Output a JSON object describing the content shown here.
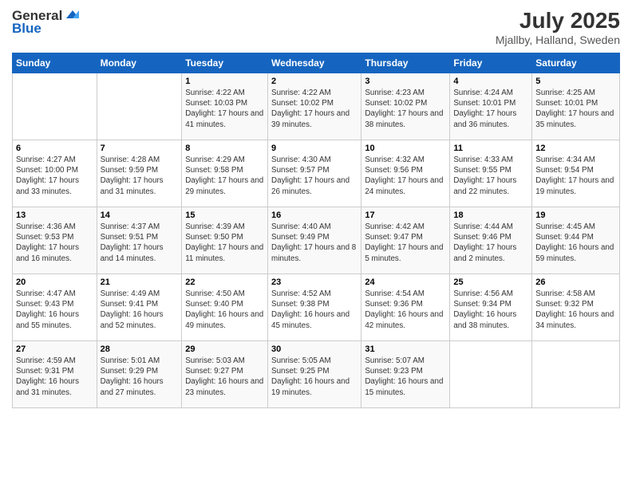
{
  "header": {
    "logo_line1": "General",
    "logo_line2": "Blue",
    "title": "July 2025",
    "subtitle": "Mjallby, Halland, Sweden"
  },
  "calendar": {
    "days_of_week": [
      "Sunday",
      "Monday",
      "Tuesday",
      "Wednesday",
      "Thursday",
      "Friday",
      "Saturday"
    ],
    "weeks": [
      [
        {
          "day": "",
          "sunrise": "",
          "sunset": "",
          "daylight": ""
        },
        {
          "day": "",
          "sunrise": "",
          "sunset": "",
          "daylight": ""
        },
        {
          "day": "1",
          "sunrise": "Sunrise: 4:22 AM",
          "sunset": "Sunset: 10:03 PM",
          "daylight": "Daylight: 17 hours and 41 minutes."
        },
        {
          "day": "2",
          "sunrise": "Sunrise: 4:22 AM",
          "sunset": "Sunset: 10:02 PM",
          "daylight": "Daylight: 17 hours and 39 minutes."
        },
        {
          "day": "3",
          "sunrise": "Sunrise: 4:23 AM",
          "sunset": "Sunset: 10:02 PM",
          "daylight": "Daylight: 17 hours and 38 minutes."
        },
        {
          "day": "4",
          "sunrise": "Sunrise: 4:24 AM",
          "sunset": "Sunset: 10:01 PM",
          "daylight": "Daylight: 17 hours and 36 minutes."
        },
        {
          "day": "5",
          "sunrise": "Sunrise: 4:25 AM",
          "sunset": "Sunset: 10:01 PM",
          "daylight": "Daylight: 17 hours and 35 minutes."
        }
      ],
      [
        {
          "day": "6",
          "sunrise": "Sunrise: 4:27 AM",
          "sunset": "Sunset: 10:00 PM",
          "daylight": "Daylight: 17 hours and 33 minutes."
        },
        {
          "day": "7",
          "sunrise": "Sunrise: 4:28 AM",
          "sunset": "Sunset: 9:59 PM",
          "daylight": "Daylight: 17 hours and 31 minutes."
        },
        {
          "day": "8",
          "sunrise": "Sunrise: 4:29 AM",
          "sunset": "Sunset: 9:58 PM",
          "daylight": "Daylight: 17 hours and 29 minutes."
        },
        {
          "day": "9",
          "sunrise": "Sunrise: 4:30 AM",
          "sunset": "Sunset: 9:57 PM",
          "daylight": "Daylight: 17 hours and 26 minutes."
        },
        {
          "day": "10",
          "sunrise": "Sunrise: 4:32 AM",
          "sunset": "Sunset: 9:56 PM",
          "daylight": "Daylight: 17 hours and 24 minutes."
        },
        {
          "day": "11",
          "sunrise": "Sunrise: 4:33 AM",
          "sunset": "Sunset: 9:55 PM",
          "daylight": "Daylight: 17 hours and 22 minutes."
        },
        {
          "day": "12",
          "sunrise": "Sunrise: 4:34 AM",
          "sunset": "Sunset: 9:54 PM",
          "daylight": "Daylight: 17 hours and 19 minutes."
        }
      ],
      [
        {
          "day": "13",
          "sunrise": "Sunrise: 4:36 AM",
          "sunset": "Sunset: 9:53 PM",
          "daylight": "Daylight: 17 hours and 16 minutes."
        },
        {
          "day": "14",
          "sunrise": "Sunrise: 4:37 AM",
          "sunset": "Sunset: 9:51 PM",
          "daylight": "Daylight: 17 hours and 14 minutes."
        },
        {
          "day": "15",
          "sunrise": "Sunrise: 4:39 AM",
          "sunset": "Sunset: 9:50 PM",
          "daylight": "Daylight: 17 hours and 11 minutes."
        },
        {
          "day": "16",
          "sunrise": "Sunrise: 4:40 AM",
          "sunset": "Sunset: 9:49 PM",
          "daylight": "Daylight: 17 hours and 8 minutes."
        },
        {
          "day": "17",
          "sunrise": "Sunrise: 4:42 AM",
          "sunset": "Sunset: 9:47 PM",
          "daylight": "Daylight: 17 hours and 5 minutes."
        },
        {
          "day": "18",
          "sunrise": "Sunrise: 4:44 AM",
          "sunset": "Sunset: 9:46 PM",
          "daylight": "Daylight: 17 hours and 2 minutes."
        },
        {
          "day": "19",
          "sunrise": "Sunrise: 4:45 AM",
          "sunset": "Sunset: 9:44 PM",
          "daylight": "Daylight: 16 hours and 59 minutes."
        }
      ],
      [
        {
          "day": "20",
          "sunrise": "Sunrise: 4:47 AM",
          "sunset": "Sunset: 9:43 PM",
          "daylight": "Daylight: 16 hours and 55 minutes."
        },
        {
          "day": "21",
          "sunrise": "Sunrise: 4:49 AM",
          "sunset": "Sunset: 9:41 PM",
          "daylight": "Daylight: 16 hours and 52 minutes."
        },
        {
          "day": "22",
          "sunrise": "Sunrise: 4:50 AM",
          "sunset": "Sunset: 9:40 PM",
          "daylight": "Daylight: 16 hours and 49 minutes."
        },
        {
          "day": "23",
          "sunrise": "Sunrise: 4:52 AM",
          "sunset": "Sunset: 9:38 PM",
          "daylight": "Daylight: 16 hours and 45 minutes."
        },
        {
          "day": "24",
          "sunrise": "Sunrise: 4:54 AM",
          "sunset": "Sunset: 9:36 PM",
          "daylight": "Daylight: 16 hours and 42 minutes."
        },
        {
          "day": "25",
          "sunrise": "Sunrise: 4:56 AM",
          "sunset": "Sunset: 9:34 PM",
          "daylight": "Daylight: 16 hours and 38 minutes."
        },
        {
          "day": "26",
          "sunrise": "Sunrise: 4:58 AM",
          "sunset": "Sunset: 9:32 PM",
          "daylight": "Daylight: 16 hours and 34 minutes."
        }
      ],
      [
        {
          "day": "27",
          "sunrise": "Sunrise: 4:59 AM",
          "sunset": "Sunset: 9:31 PM",
          "daylight": "Daylight: 16 hours and 31 minutes."
        },
        {
          "day": "28",
          "sunrise": "Sunrise: 5:01 AM",
          "sunset": "Sunset: 9:29 PM",
          "daylight": "Daylight: 16 hours and 27 minutes."
        },
        {
          "day": "29",
          "sunrise": "Sunrise: 5:03 AM",
          "sunset": "Sunset: 9:27 PM",
          "daylight": "Daylight: 16 hours and 23 minutes."
        },
        {
          "day": "30",
          "sunrise": "Sunrise: 5:05 AM",
          "sunset": "Sunset: 9:25 PM",
          "daylight": "Daylight: 16 hours and 19 minutes."
        },
        {
          "day": "31",
          "sunrise": "Sunrise: 5:07 AM",
          "sunset": "Sunset: 9:23 PM",
          "daylight": "Daylight: 16 hours and 15 minutes."
        },
        {
          "day": "",
          "sunrise": "",
          "sunset": "",
          "daylight": ""
        },
        {
          "day": "",
          "sunrise": "",
          "sunset": "",
          "daylight": ""
        }
      ]
    ]
  }
}
